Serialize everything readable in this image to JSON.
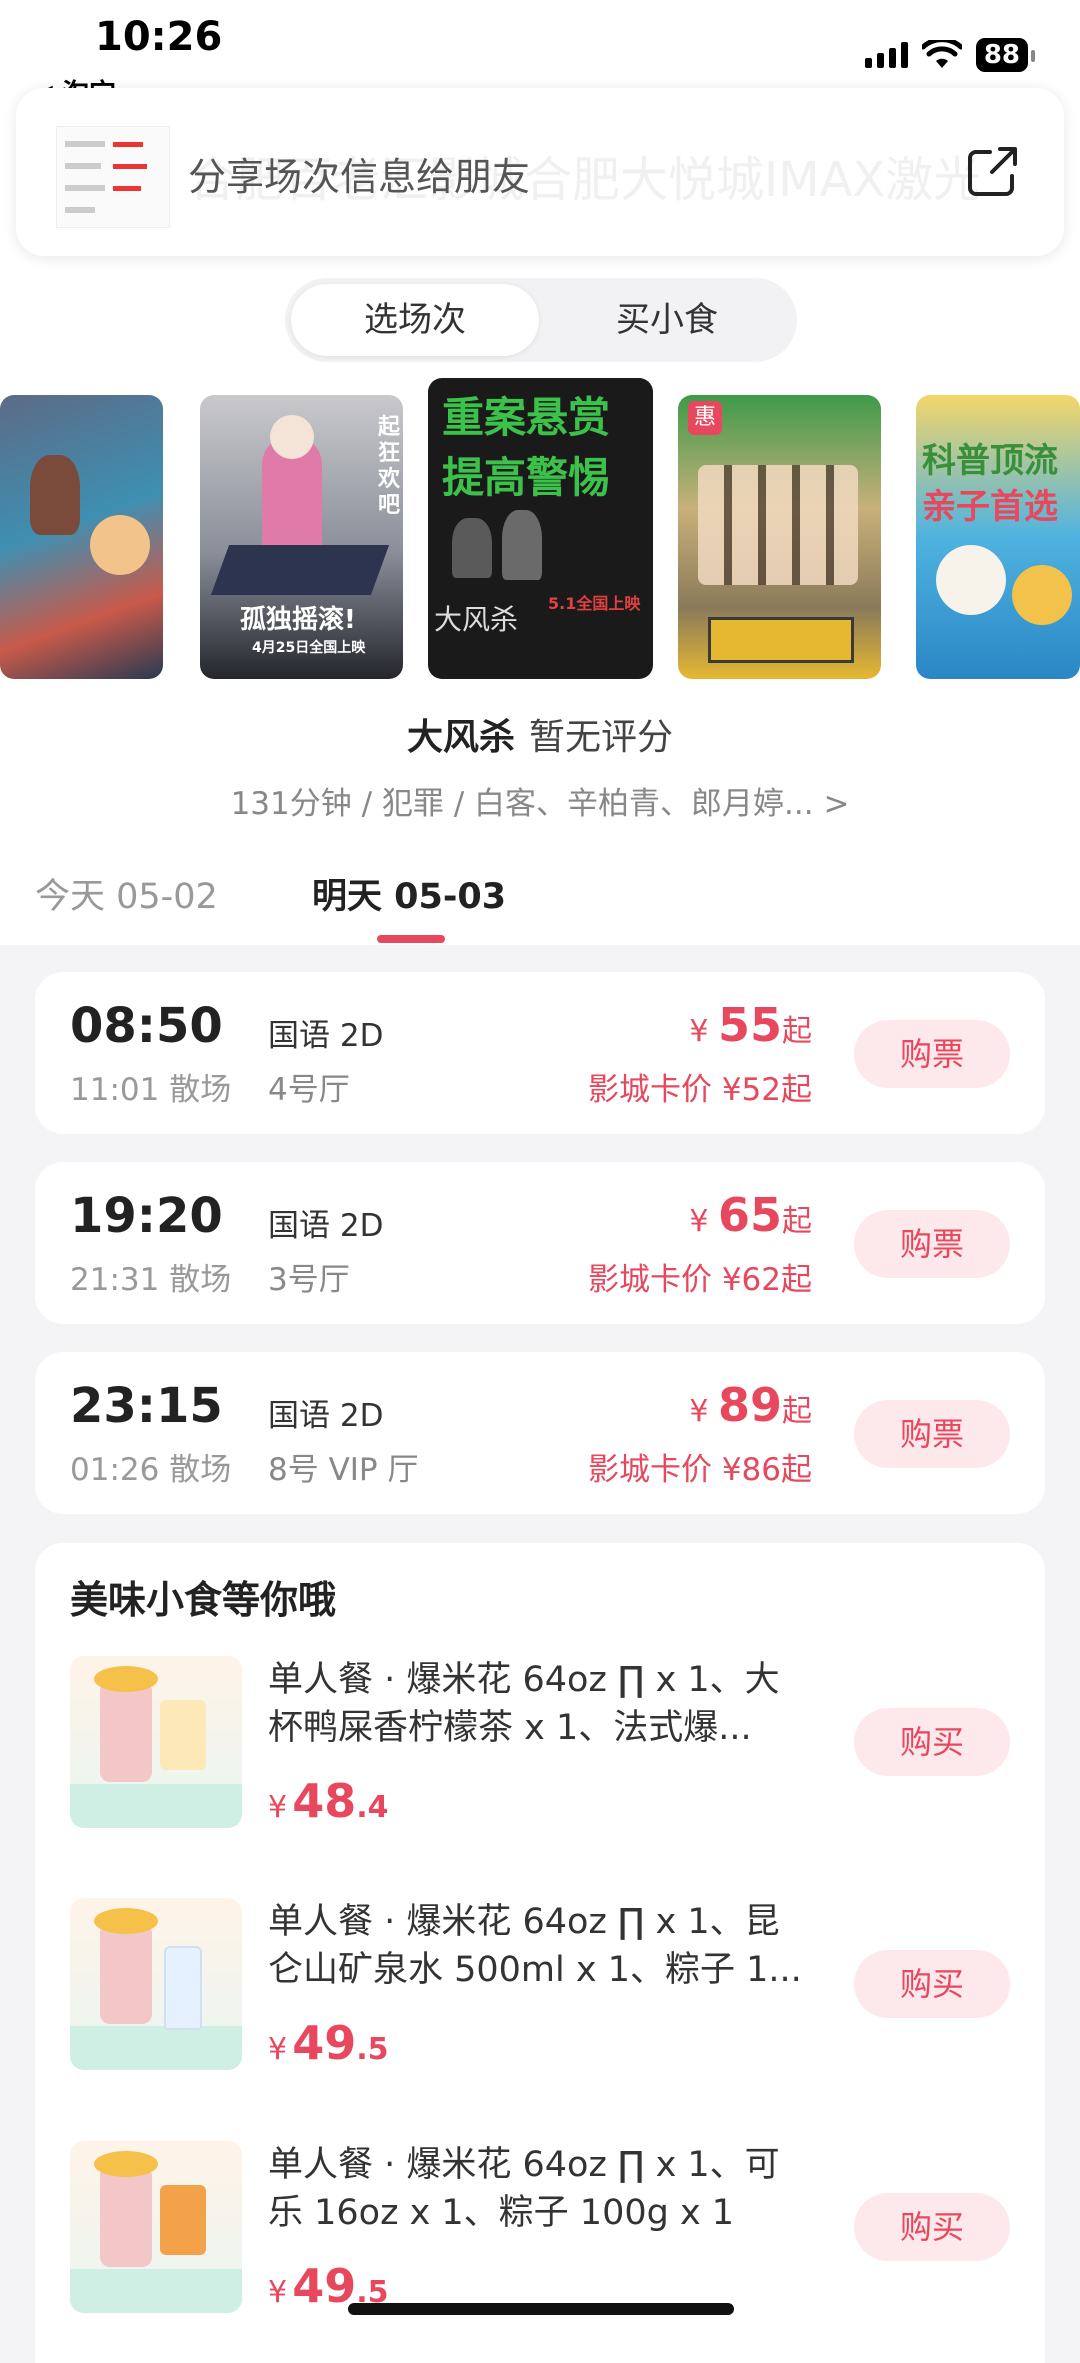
{
  "status_bar": {
    "time": "10:26",
    "back_app": "◀ 淘宝",
    "battery": "88"
  },
  "share": {
    "text": "分享场次信息给朋友",
    "background_text": "合肥百老汇影城合肥大悦城IMAX激光店"
  },
  "segments": {
    "tab1": "选场次",
    "tab2": "买小食"
  },
  "posters": [
    {
      "name": "poster-1",
      "text": ""
    },
    {
      "name": "poster-2",
      "text": "孤独摇滚!",
      "sub": "4月25日全国上映",
      "side": "起狂欢吧!"
    },
    {
      "name": "poster-3",
      "text": "重案悬赏",
      "text2": "提高警惕",
      "sub": "大风杀",
      "date": "5.1全国上映"
    },
    {
      "name": "poster-4",
      "badge": "惠"
    },
    {
      "name": "poster-5",
      "text": "科普顶流",
      "text2": "亲子首选"
    }
  ],
  "movie": {
    "name": "大风杀",
    "rating": "暂无评分",
    "meta": "131分钟 / 犯罪 / 白客、辛柏青、郎月婷... >"
  },
  "dates": {
    "today": "今天  05-02",
    "tomorrow": "明天  05-03"
  },
  "sessions": [
    {
      "time": "08:50",
      "end": "11:01 散场",
      "lang": "国语 2D",
      "hall": "4号厅",
      "yen": "¥",
      "price": "55",
      "suffix": "起",
      "card_price": "影城卡价 ¥52起",
      "button": "购票"
    },
    {
      "time": "19:20",
      "end": "21:31 散场",
      "lang": "国语 2D",
      "hall": "3号厅",
      "yen": "¥",
      "price": "65",
      "suffix": "起",
      "card_price": "影城卡价 ¥62起",
      "button": "购票"
    },
    {
      "time": "23:15",
      "end": "01:26 散场",
      "lang": "国语 2D",
      "hall": "8号 VIP 厅",
      "yen": "¥",
      "price": "89",
      "suffix": "起",
      "card_price": "影城卡价 ¥86起",
      "button": "购票"
    }
  ],
  "snacks": {
    "heading": "美味小食等你哦",
    "items": [
      {
        "desc": "单人餐 · 爆米花 64oz ∏  x 1、大杯鸭屎香柠檬茶 x 1、法式爆...",
        "yen": "¥",
        "int": "48",
        "dec": ".4",
        "button": "购买"
      },
      {
        "desc": "单人餐 · 爆米花 64oz ∏  x 1、昆仑山矿泉水 500ml x 1、粽子 1...",
        "yen": "¥",
        "int": "49",
        "dec": ".5",
        "button": "购买"
      },
      {
        "desc": "单人餐 · 爆米花 64oz ∏  x 1、可乐 16oz x 1、粽子 100g x 1",
        "yen": "¥",
        "int": "49",
        "dec": ".5",
        "button": "购买"
      }
    ]
  },
  "colors": {
    "accent": "#e8485e",
    "pill_bg": "#fde8ec",
    "page_bg": "#f4f4f6"
  }
}
